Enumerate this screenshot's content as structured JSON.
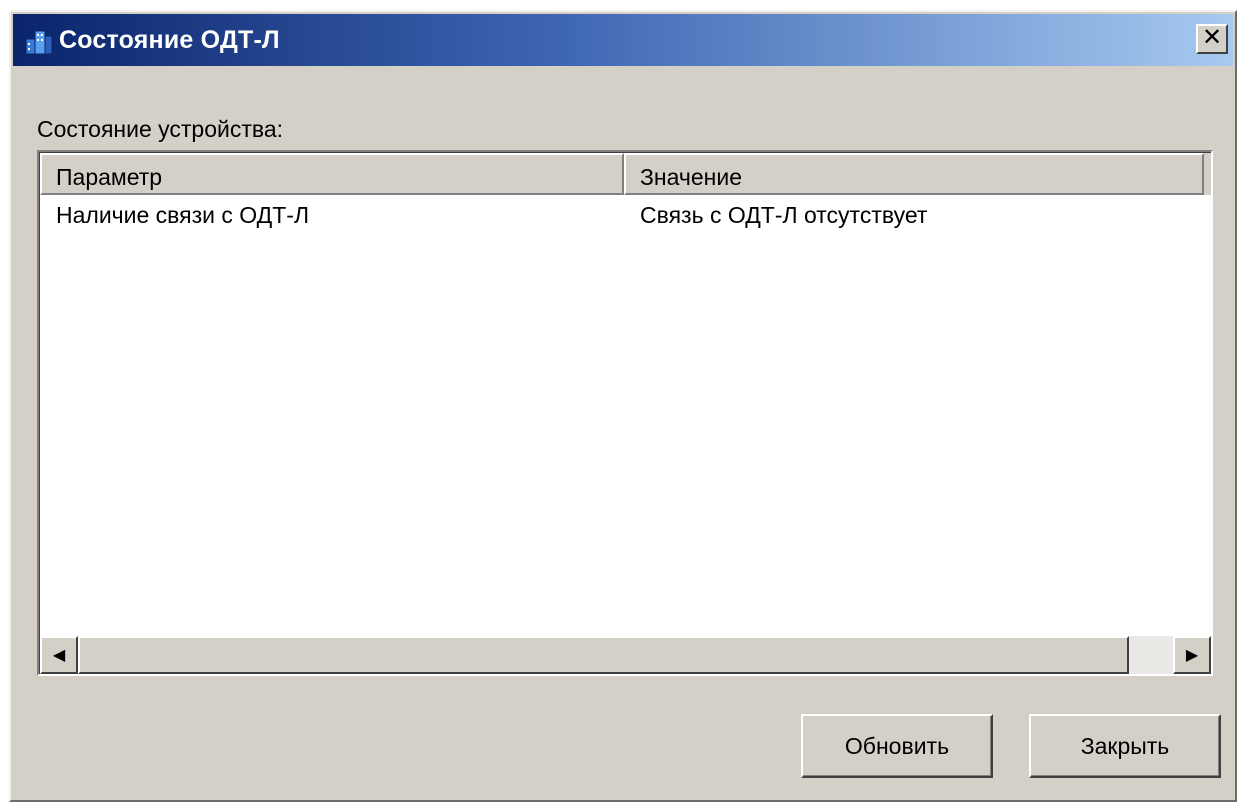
{
  "window": {
    "title": "Состояние ОДТ-Л",
    "close_glyph": "✕",
    "colors": {
      "titlebar_start": "#0a246a",
      "titlebar_end": "#a6caf0",
      "face": "#d4d0c8"
    }
  },
  "panel": {
    "label": "Состояние устройства:"
  },
  "table": {
    "columns": [
      "Параметр",
      "Значение"
    ],
    "rows": [
      [
        "Наличие связи с ОДТ-Л",
        "Связь с ОДТ-Л отсутствует"
      ]
    ]
  },
  "scrollbar": {
    "left_arrow": "◀",
    "right_arrow": "▶"
  },
  "buttons": {
    "refresh_label": "Обновить",
    "close_label": "Закрыть"
  }
}
